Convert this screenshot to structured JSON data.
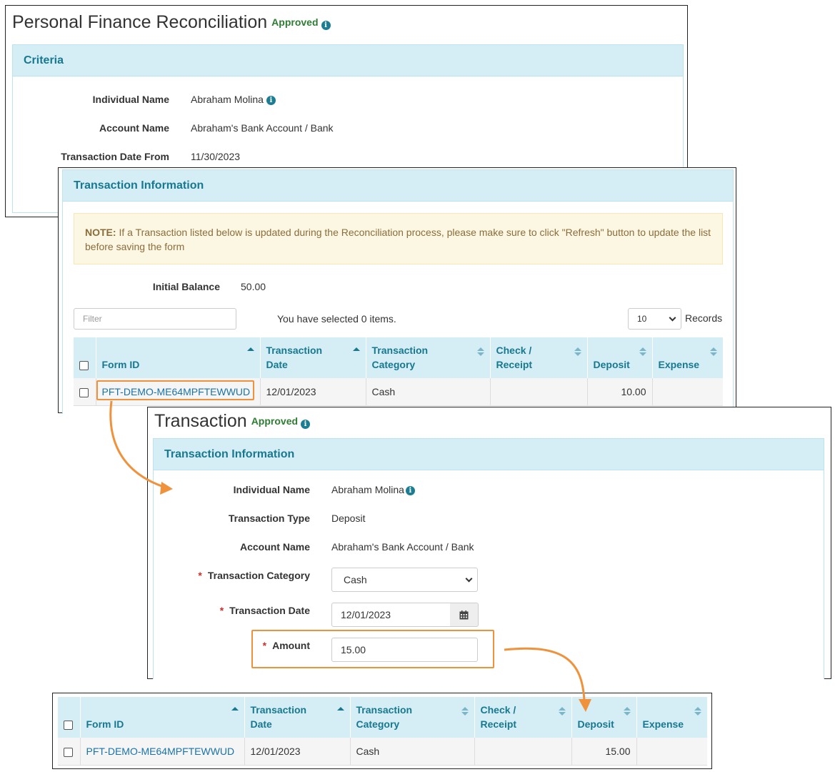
{
  "recon": {
    "title": "Personal Finance Reconciliation",
    "status": "Approved",
    "criteria": {
      "heading": "Criteria",
      "fields": [
        {
          "label": "Individual Name",
          "value": "Abraham Molina"
        },
        {
          "label": "Account Name",
          "value": "Abraham's Bank Account / Bank"
        },
        {
          "label": "Transaction Date From",
          "value": "11/30/2023"
        }
      ]
    }
  },
  "txinfo": {
    "heading": "Transaction Information",
    "note_bold": "NOTE:",
    "note_text": " If a Transaction listed below is updated during the Reconciliation process, please make sure to click \"Refresh\" button to update the list before saving the form",
    "initial_balance_label": "Initial Balance",
    "initial_balance_value": "50.00",
    "filter_placeholder": "Filter",
    "selected_text": "You have selected 0 items.",
    "page_size": "10",
    "records_label": "Records",
    "columns": {
      "form_id": "Form ID",
      "tx_date_1": "Transaction",
      "tx_date_2": "Date",
      "tx_cat_1": "Transaction",
      "tx_cat_2": "Category",
      "check_1": "Check /",
      "check_2": "Receipt",
      "deposit": "Deposit",
      "expense": "Expense"
    },
    "row": {
      "form_id": "PFT-DEMO-ME64MPFTEWWUD",
      "date": "12/01/2023",
      "category": "Cash",
      "check": "",
      "deposit": "10.00",
      "expense": ""
    }
  },
  "transaction": {
    "title": "Transaction",
    "status": "Approved",
    "heading": "Transaction Information",
    "individual_label": "Individual Name",
    "individual_value": "Abraham Molina",
    "type_label": "Transaction Type",
    "type_value": "Deposit",
    "account_label": "Account Name",
    "account_value": "Abraham's Bank Account / Bank",
    "category_label": "Transaction Category",
    "category_value": "Cash",
    "date_label": "Transaction Date",
    "date_value": "12/01/2023",
    "amount_label": "Amount",
    "amount_value": "15.00"
  },
  "result": {
    "row": {
      "form_id": "PFT-DEMO-ME64MPFTEWWUD",
      "date": "12/01/2023",
      "category": "Cash",
      "check": "",
      "deposit": "15.00",
      "expense": ""
    }
  },
  "colors": {
    "accent": "#17788f",
    "panel_head": "#d5eef6",
    "approved": "#2e7d32",
    "highlight": "#f0913c",
    "link": "#1a73a8"
  }
}
